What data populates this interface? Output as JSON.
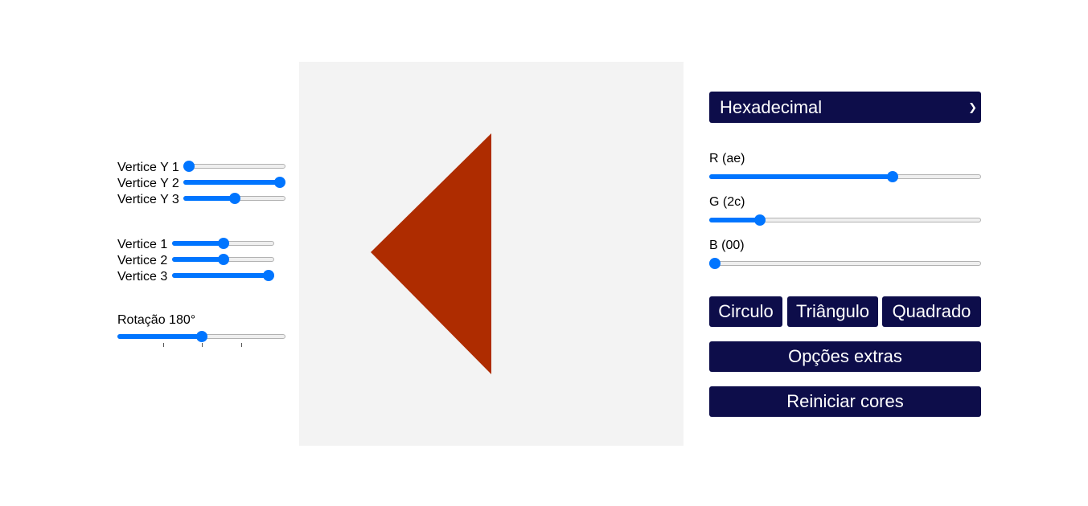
{
  "vertex_y_sliders": [
    {
      "label": "Vertice Y 1",
      "value": 0.0
    },
    {
      "label": "Vertice Y 2",
      "value": 1.0
    },
    {
      "label": "Vertice Y 3",
      "value": 0.5
    }
  ],
  "vertex_sliders": [
    {
      "label": "Vertice 1",
      "value": 0.5
    },
    {
      "label": "Vertice 2",
      "value": 0.5
    },
    {
      "label": "Vertice 3",
      "value": 1.0
    }
  ],
  "rotation": {
    "label": "Rotação 180°",
    "value": 0.5
  },
  "shape": {
    "fill_color": "#ae2c00"
  },
  "color_mode": {
    "selected": "Hexadecimal"
  },
  "rgb_sliders": [
    {
      "label": "R (ae)",
      "value": 0.682
    },
    {
      "label": "G (2c)",
      "value": 0.173
    },
    {
      "label": "B (00)",
      "value": 0.0
    }
  ],
  "shape_buttons": {
    "circle": "Circulo",
    "triangle": "Triângulo",
    "square": "Quadrado"
  },
  "extra_options_label": "Opções extras",
  "reset_colors_label": "Reiniciar cores",
  "colors": {
    "accent": "#0075ff",
    "button_bg": "#0d0d4a",
    "canvas_bg": "#f3f3f3"
  }
}
